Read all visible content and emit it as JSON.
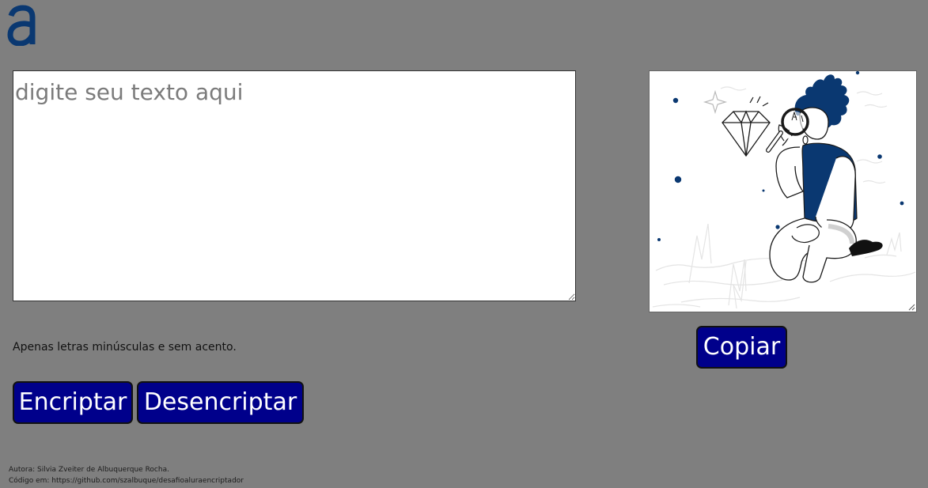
{
  "header": {
    "logo_icon": "alura-a-logo-icon",
    "logo_color": "#0a3871"
  },
  "editor": {
    "placeholder": "digite seu texto aqui",
    "value": ""
  },
  "output": {
    "illustration_icon": "person-with-magnifying-glass-and-diamond-illustration"
  },
  "hint": {
    "text": "Apenas letras minúsculas e sem acento."
  },
  "buttons": {
    "encrypt_label": "Encriptar",
    "decrypt_label": "Desencriptar",
    "copy_label": "Copiar"
  },
  "footer": {
    "author": "Autora: Silvia Zveiter de Albuquerque Rocha.",
    "code": "Código em: https://github.com/szalbuque/desafioaluraencriptador"
  },
  "colors": {
    "background": "#7f7f7f",
    "button_bg": "#00008b",
    "button_text": "#ffffff",
    "accent": "#0a3871"
  }
}
